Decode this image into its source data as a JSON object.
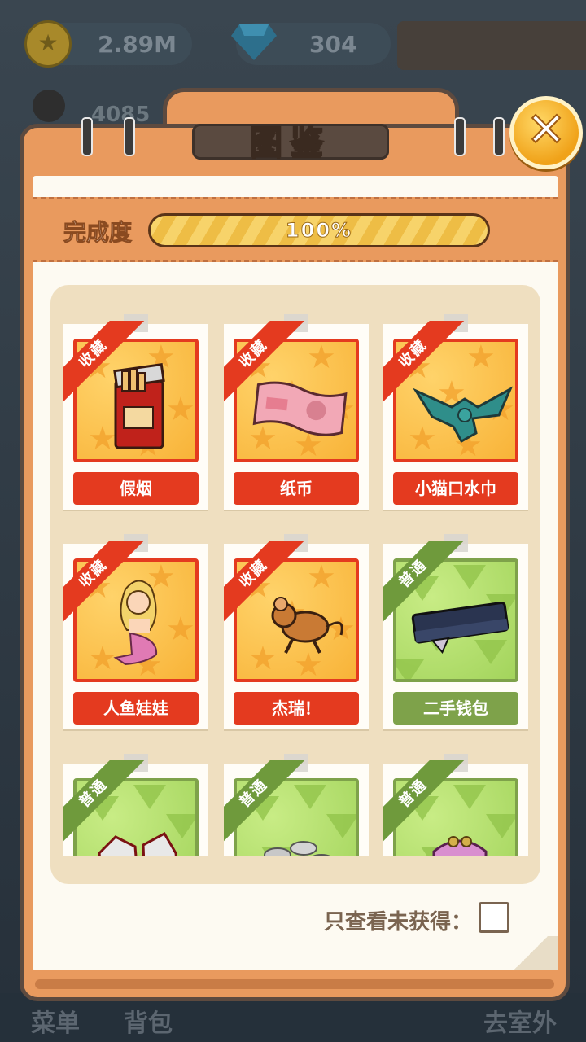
{
  "hud": {
    "coins": "2.89M",
    "gems": "304",
    "score": "4085",
    "bottom_menu": "菜单",
    "bottom_bag": "背包",
    "bottom_outdoor": "去室外"
  },
  "dialog": {
    "title": "图鉴",
    "close_icon": "close-x",
    "progress_label": "完成度",
    "progress_value": 1.0,
    "progress_text": "100%",
    "filter_label": "只查看未获得：",
    "filter_checked": false
  },
  "items": [
    {
      "name": "假烟",
      "rarity": "收藏",
      "tier": "rare",
      "icon": "cigarette-pack"
    },
    {
      "name": "纸币",
      "rarity": "收藏",
      "tier": "rare",
      "icon": "banknote"
    },
    {
      "name": "小猫口水巾",
      "rarity": "收藏",
      "tier": "rare",
      "icon": "bib"
    },
    {
      "name": "人鱼娃娃",
      "rarity": "收藏",
      "tier": "rare",
      "icon": "mermaid-doll"
    },
    {
      "name": "杰瑞！",
      "rarity": "收藏",
      "tier": "rare",
      "icon": "jerry-mouse"
    },
    {
      "name": "二手钱包",
      "rarity": "普通",
      "tier": "common",
      "icon": "wallet"
    },
    {
      "name": "",
      "rarity": "普通",
      "tier": "common",
      "icon": "sneakers"
    },
    {
      "name": "",
      "rarity": "普通",
      "tier": "common",
      "icon": "coins"
    },
    {
      "name": "",
      "rarity": "普通",
      "tier": "common",
      "icon": "coin-purse"
    }
  ],
  "colors": {
    "frame": "#e99a5e",
    "rare": "#e43a1f",
    "common": "#7ea24a",
    "gold": "#f7d36a"
  }
}
